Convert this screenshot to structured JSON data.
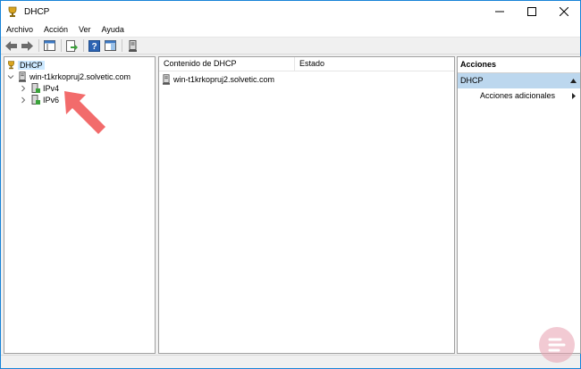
{
  "window": {
    "title": "DHCP"
  },
  "menu": [
    "Archivo",
    "Acción",
    "Ver",
    "Ayuda"
  ],
  "tree": {
    "root": "DHCP",
    "server": "win-t1krkopruj2.solvetic.com",
    "children": [
      "IPv4",
      "IPv6"
    ]
  },
  "content": {
    "columns": [
      "Contenido de DHCP",
      "Estado"
    ],
    "rows": [
      {
        "name": "win-t1krkopruj2.solvetic.com",
        "status": ""
      }
    ]
  },
  "actions": {
    "header": "Acciones",
    "section": "DHCP",
    "items": [
      "Acciones adicionales"
    ]
  },
  "colors": {
    "accent": "#1883d7",
    "selection": "#cce8ff",
    "section_bg": "#bcd7ee",
    "arrow": "#f26b6b"
  }
}
